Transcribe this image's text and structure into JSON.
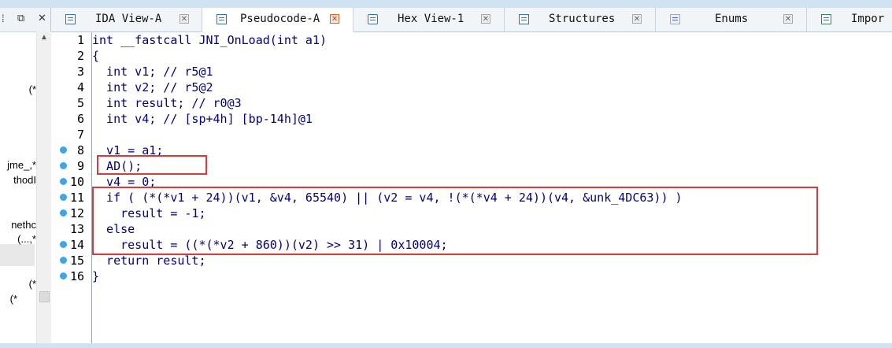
{
  "left_panel": {
    "texts": [
      "*)",
      "*,_jme",
      "thodI",
      "nethc",
      "*,...)",
      "*)",
      "*)"
    ]
  },
  "tabs": [
    {
      "label": "IDA View-A",
      "icon": "ida-view-icon"
    },
    {
      "label": "Pseudocode-A",
      "icon": "pseudocode-icon"
    },
    {
      "label": "Hex View-1",
      "icon": "hex-view-icon"
    },
    {
      "label": "Structures",
      "icon": "structures-icon"
    },
    {
      "label": "Enums",
      "icon": "enums-icon"
    },
    {
      "label": "Impor",
      "icon": "imports-icon"
    }
  ],
  "code": {
    "lines": [
      {
        "num": "1",
        "text": "int __fastcall JNI_OnLoad(int a1)",
        "bp": false
      },
      {
        "num": "2",
        "text": "{",
        "bp": false
      },
      {
        "num": "3",
        "text": "  int v1; // r5@1",
        "bp": false
      },
      {
        "num": "4",
        "text": "  int v2; // r5@2",
        "bp": false
      },
      {
        "num": "5",
        "text": "  int result; // r0@3",
        "bp": false
      },
      {
        "num": "6",
        "text": "  int v4; // [sp+4h] [bp-14h]@1",
        "bp": false
      },
      {
        "num": "7",
        "text": "",
        "bp": false
      },
      {
        "num": "8",
        "text": "  v1 = a1;",
        "bp": true
      },
      {
        "num": "9",
        "text": "  AD();",
        "bp": true
      },
      {
        "num": "10",
        "text": "  v4 = 0;",
        "bp": true
      },
      {
        "num": "11",
        "text": "  if ( (*(*v1 + 24))(v1, &v4, 65540) || (v2 = v4, !(*(*v4 + 24))(v4, &unk_4DC63)) )",
        "bp": true
      },
      {
        "num": "12",
        "text": "    result = -1;",
        "bp": true
      },
      {
        "num": "13",
        "text": "  else",
        "bp": false
      },
      {
        "num": "14",
        "text": "    result = ((*(*v2 + 860))(v2) >> 31) | 0x10004;",
        "bp": true
      },
      {
        "num": "15",
        "text": "  return result;",
        "bp": true
      },
      {
        "num": "16",
        "text": "}",
        "bp": true
      }
    ]
  },
  "colors": {
    "code_text": "#000080",
    "highlight_box": "#e03838",
    "breakpoint_dot": "#3ea6e6"
  }
}
